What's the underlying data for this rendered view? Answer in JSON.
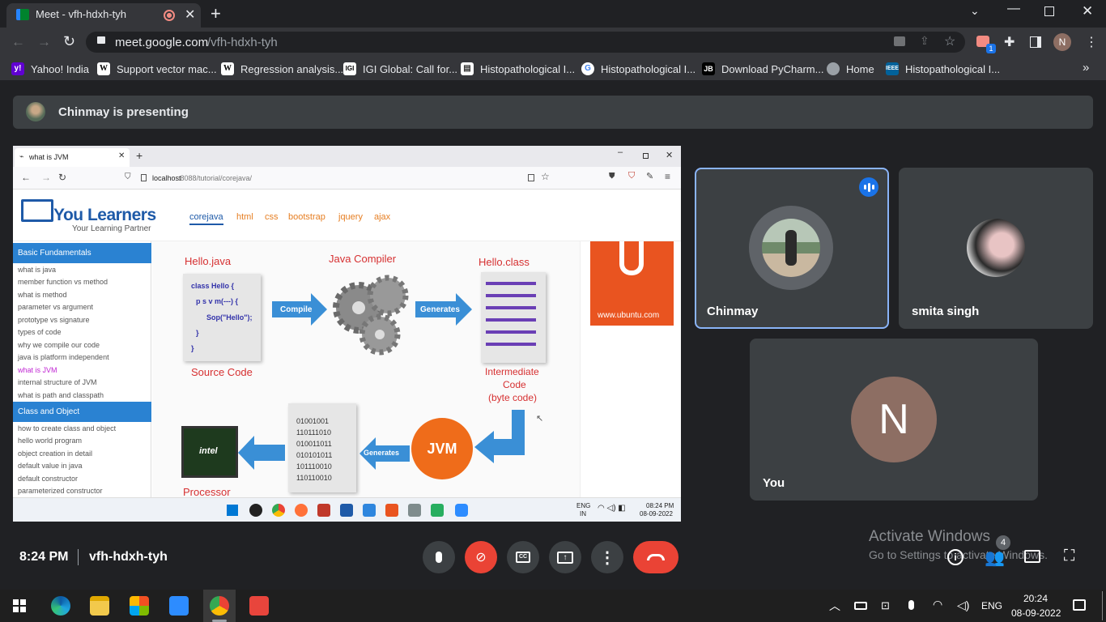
{
  "browser": {
    "tab_title": "Meet - vfh-hdxh-tyh",
    "url_domain": "meet.google.com",
    "url_path": "/vfh-hdxh-tyh",
    "profile_initial": "N",
    "extension_badge": "1"
  },
  "bookmarks": [
    {
      "label": "Yahoo! India",
      "icon": "yahoo-icon",
      "color": "#6001d2"
    },
    {
      "label": "Support vector mac...",
      "icon": "wikipedia-icon",
      "color": "#ffffff"
    },
    {
      "label": "Regression analysis...",
      "icon": "wikipedia-icon",
      "color": "#ffffff"
    },
    {
      "label": "IGI Global: Call for...",
      "icon": "igi-icon",
      "color": "#ffffff"
    },
    {
      "label": "Histopathological I...",
      "icon": "document-icon",
      "color": "#ffffff"
    },
    {
      "label": "Histopathological I...",
      "icon": "google-icon",
      "color": "#4285f4"
    },
    {
      "label": "Download PyCharm...",
      "icon": "jetbrains-icon",
      "color": "#000000"
    },
    {
      "label": "Home",
      "icon": "globe-icon",
      "color": "#9aa0a6"
    },
    {
      "label": "Histopathological I...",
      "icon": "ieee-icon",
      "color": "#00629b"
    }
  ],
  "meet": {
    "presenting_text": "Chinmay is presenting",
    "participants": [
      {
        "name": "Chinmay"
      },
      {
        "name": "smita singh"
      },
      {
        "name": "You",
        "initial": "N"
      }
    ],
    "time": "8:24 PM",
    "meeting_code": "vfh-hdxh-tyh",
    "people_count": "4",
    "watermark_line1": "Activate Windows",
    "watermark_line2": "Go to Settings to activate Windows."
  },
  "shared": {
    "tab_title": "what is JVM",
    "url_host": "localhost",
    "url_rest": ":8088/tutorial/corejava/",
    "logo_main": "You Learners",
    "logo_tagline": "Your Learning Partner",
    "nav": [
      "corejava",
      "html",
      "css",
      "bootstrap",
      "jquery",
      "ajax"
    ],
    "section1": "Basic Fundamentals",
    "links1": [
      "what is java",
      "member function vs method",
      "what is method",
      "parameter vs argument",
      "prototype vs signature",
      "types of code",
      "why we compile our code",
      "java is platform independent",
      "what is JVM",
      "internal structure of JVM",
      "what is path and classpath"
    ],
    "section2": "Class and Object",
    "links2": [
      "how to create class and object",
      "hello world program",
      "object creation in detail",
      "default value in java",
      "default constructor",
      "parameterized constructor"
    ],
    "diagram": {
      "hello_java": "Hello.java",
      "java_compiler": "Java  Compiler",
      "hello_class": "Hello.class",
      "code_lines": [
        "class Hello {",
        "p s v m(---) {",
        "Sop(\"Hello\");",
        "}",
        "}"
      ],
      "compile": "Compile",
      "generates1": "Generates",
      "source_code": "Source Code",
      "intermediate1": "Intermediate",
      "intermediate2": "Code",
      "intermediate3": "(byte code)",
      "binary": [
        "01001001",
        "110111010",
        "010011011",
        "010101011",
        "101110010",
        "110110010"
      ],
      "generates2": "Generates",
      "jvm": "JVM",
      "processor": "Processor",
      "intel": "intel",
      "ubuntu_url": "www.ubuntu.com"
    },
    "tray_lang1": "ENG",
    "tray_lang2": "IN",
    "tray_time": "08:24 PM",
    "tray_date": "08-09-2022"
  },
  "taskbar": {
    "lang": "ENG",
    "time": "20:24",
    "date": "08-09-2022"
  }
}
